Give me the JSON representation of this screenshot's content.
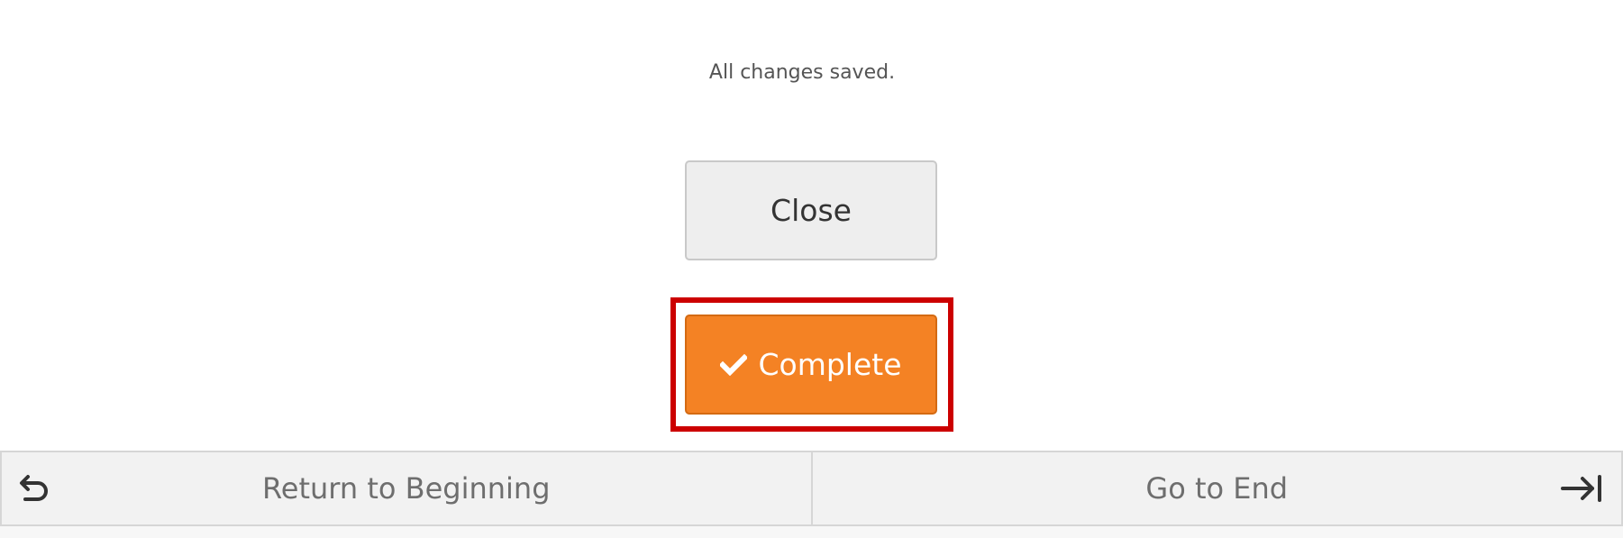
{
  "status": {
    "message": "All changes saved."
  },
  "buttons": {
    "close_label": "Close",
    "complete_label": "Complete",
    "complete_icon": "checkmark-icon"
  },
  "footer": {
    "return_label": "Return to Beginning",
    "return_icon": "undo-arrow-icon",
    "end_label": "Go to End",
    "end_icon": "arrow-to-end-icon"
  },
  "colors": {
    "complete_accent": "#f48224",
    "highlight_frame": "#cc0000"
  }
}
